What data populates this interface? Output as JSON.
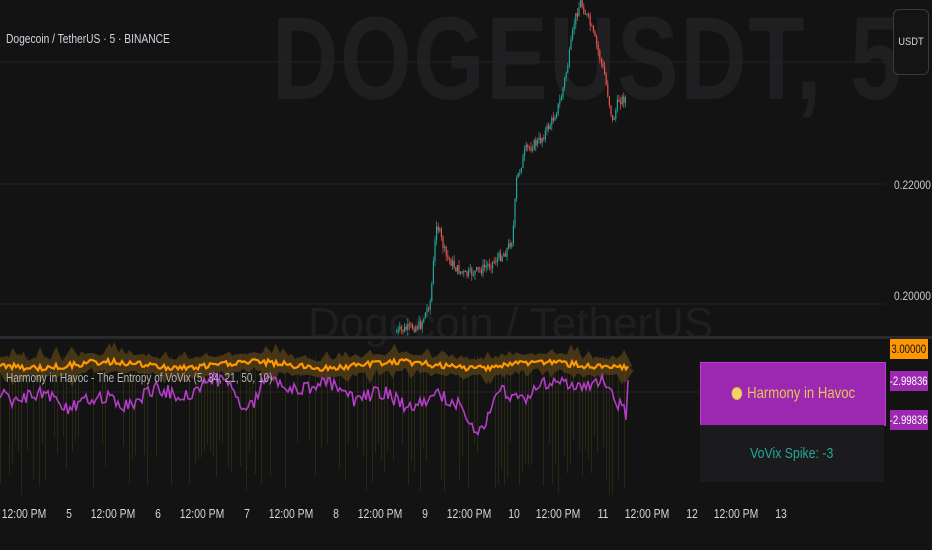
{
  "watermark": {
    "symbol": "DOGEUSDT, 5",
    "description": "Dogecoin / TetherUS"
  },
  "header": {
    "symbol_title": "Dogecoin / TetherUS · 5 · BINANCE",
    "currency_button": "USDT"
  },
  "price_axis": {
    "labels": [
      "0.22000",
      "0.20000"
    ]
  },
  "indicator": {
    "title": "Harmony in Havoc - The Entropy of VoVix (5, 34, 21, 50, 10)",
    "badges": {
      "upper": "3.00000",
      "mid": "-2.99836",
      "low": "-2.99836"
    },
    "harmony_label": "Harmony in Havoc",
    "spike_label": "VoVix Spike: -3",
    "colors": {
      "upper_line": "#ff9800",
      "lower_line": "#b43cc8",
      "panel_box": "#9c27b0",
      "spike_text": "#26a69a"
    }
  },
  "time_axis": {
    "labels": [
      "12:00 PM",
      "5",
      "12:00 PM",
      "6",
      "12:00 PM",
      "7",
      "12:00 PM",
      "8",
      "12:00 PM",
      "9",
      "12:00 PM",
      "10",
      "12:00 PM",
      "11",
      "12:00 PM",
      "12",
      "12:00 PM",
      "13"
    ]
  },
  "colors": {
    "bg": "#131313",
    "up_candle": "#26a69a",
    "down_candle": "#ef5350"
  }
}
